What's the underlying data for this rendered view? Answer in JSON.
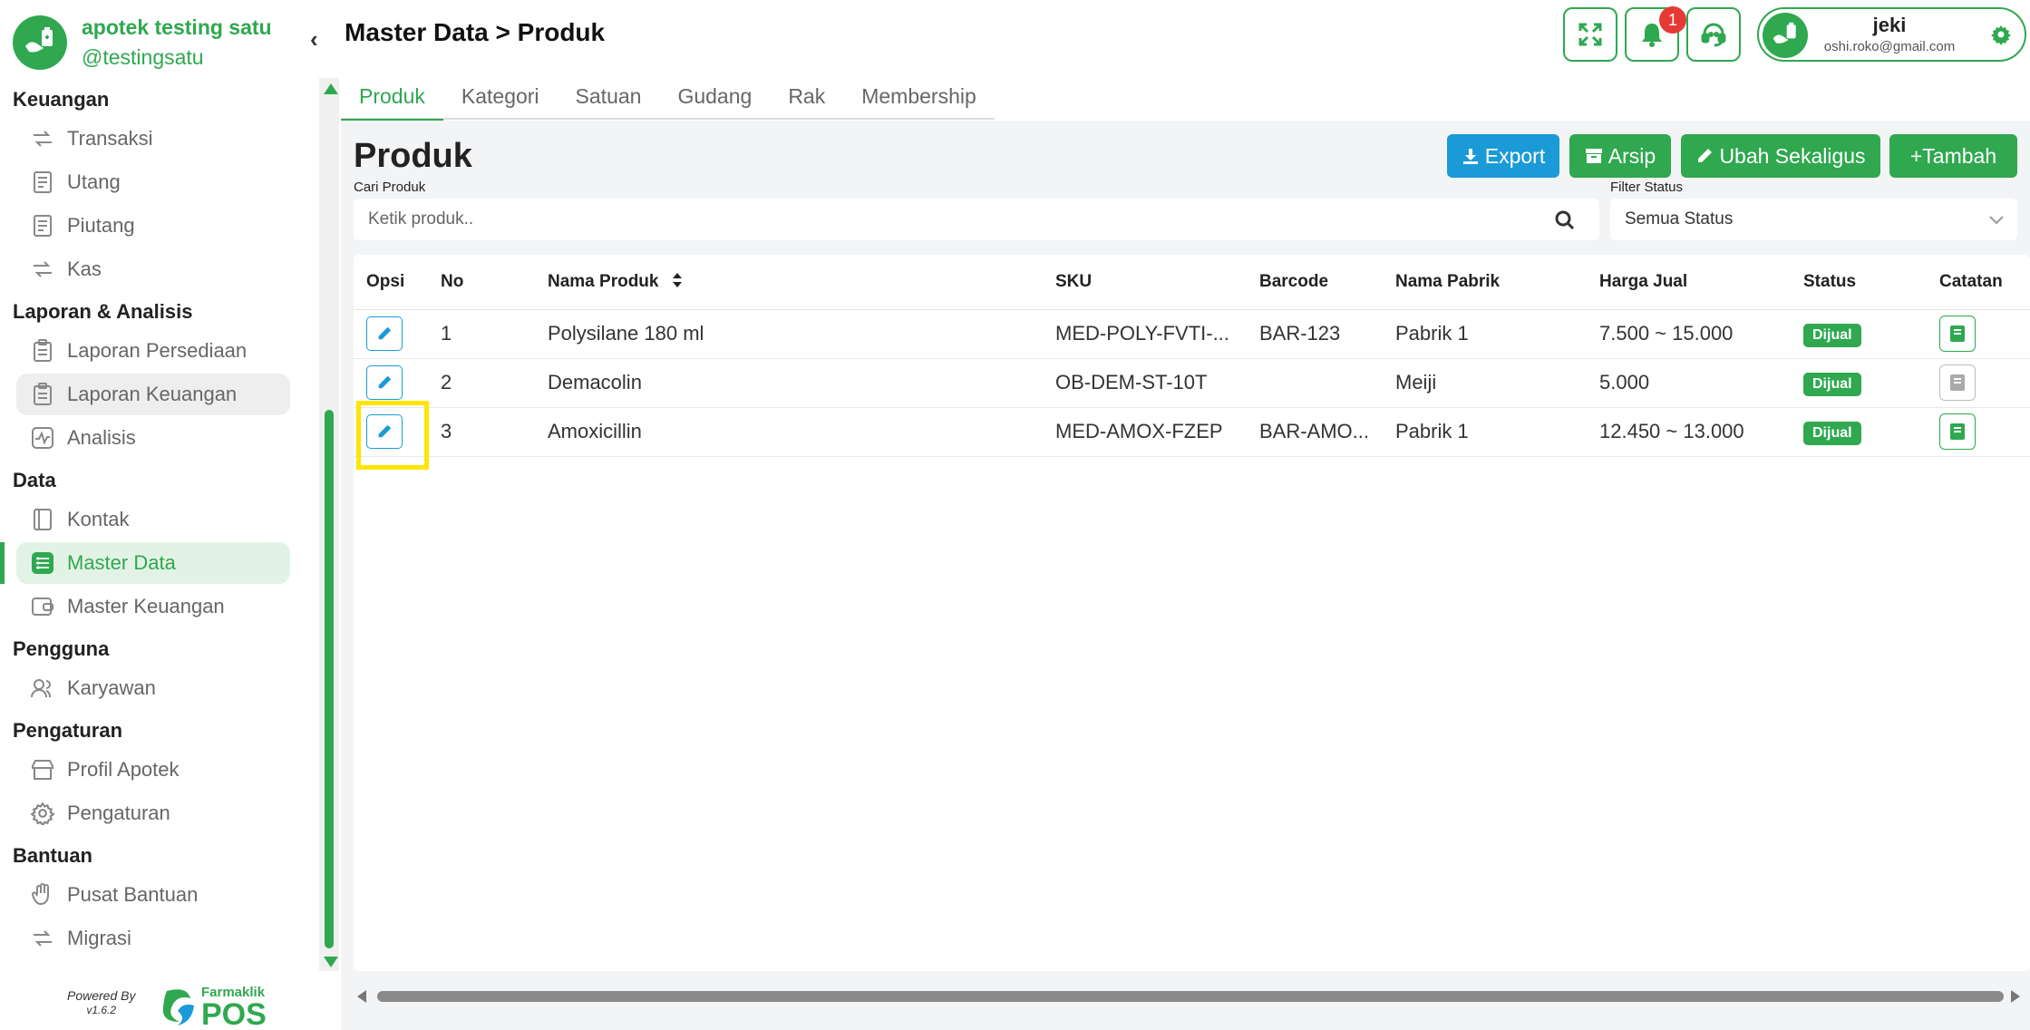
{
  "brand": {
    "name": "apotek testing satu",
    "handle": "@testingsatu"
  },
  "sidebar": {
    "sections": [
      {
        "title": "Keuangan",
        "items": [
          {
            "label": "Transaksi",
            "icon": "transfer-icon"
          },
          {
            "label": "Utang",
            "icon": "receipt-icon"
          },
          {
            "label": "Piutang",
            "icon": "receipt-icon"
          },
          {
            "label": "Kas",
            "icon": "transfer-icon"
          }
        ]
      },
      {
        "title": "Laporan & Analisis",
        "items": [
          {
            "label": "Laporan Persediaan",
            "icon": "clipboard-icon"
          },
          {
            "label": "Laporan Keuangan",
            "icon": "clipboard-icon"
          },
          {
            "label": "Analisis",
            "icon": "pulse-icon"
          }
        ]
      },
      {
        "title": "Data",
        "items": [
          {
            "label": "Kontak",
            "icon": "contact-book-icon"
          },
          {
            "label": "Master Data",
            "icon": "database-icon"
          },
          {
            "label": "Master Keuangan",
            "icon": "wallet-icon"
          }
        ]
      },
      {
        "title": "Pengguna",
        "items": [
          {
            "label": "Karyawan",
            "icon": "users-icon"
          }
        ]
      },
      {
        "title": "Pengaturan",
        "items": [
          {
            "label": "Profil Apotek",
            "icon": "store-icon"
          },
          {
            "label": "Pengaturan",
            "icon": "gear-icon"
          }
        ]
      },
      {
        "title": "Bantuan",
        "items": [
          {
            "label": "Pusat Bantuan",
            "icon": "hand-icon"
          },
          {
            "label": "Migrasi",
            "icon": "transfer-icon"
          }
        ]
      }
    ],
    "active_item": "Master Data",
    "hover_item": "Laporan Keuangan"
  },
  "footer": {
    "powered_by": "Powered By",
    "version": "v1.6.2",
    "logo_small": "Farmaklik",
    "logo_big": "POS"
  },
  "header": {
    "title": "Master Data > Produk",
    "notification_count": "1",
    "user": {
      "name": "jeki",
      "email": "oshi.roko@gmail.com"
    }
  },
  "tabs": [
    "Produk",
    "Kategori",
    "Satuan",
    "Gudang",
    "Rak",
    "Membership"
  ],
  "active_tab": "Produk",
  "main": {
    "title": "Produk",
    "buttons": {
      "export": "Export",
      "archive": "Arsip",
      "bulk_edit": "Ubah Sekaligus",
      "add": "+Tambah"
    },
    "search_label": "Cari Produk",
    "search_placeholder": "Ketik produk..",
    "filter_label": "Filter Status",
    "filter_value": "Semua Status"
  },
  "table": {
    "headers": {
      "opsi": "Opsi",
      "no": "No",
      "nama": "Nama Produk",
      "sku": "SKU",
      "barcode": "Barcode",
      "pabrik": "Nama Pabrik",
      "harga": "Harga Jual",
      "status": "Status",
      "catatan": "Catatan"
    },
    "rows": [
      {
        "no": "1",
        "nama": "Polysilane 180 ml",
        "sku": "MED-POLY-FVTI-...",
        "barcode": "BAR-123",
        "pabrik": "Pabrik 1",
        "harga": "7.500 ~ 15.000",
        "status": "Dijual",
        "has_note": true
      },
      {
        "no": "2",
        "nama": "Demacolin",
        "sku": "OB-DEM-ST-10T",
        "barcode": "",
        "pabrik": "Meiji",
        "harga": "5.000",
        "status": "Dijual",
        "has_note": false
      },
      {
        "no": "3",
        "nama": "Amoxicillin",
        "sku": "MED-AMOX-FZEP",
        "barcode": "BAR-AMO...",
        "pabrik": "Pabrik 1",
        "harga": "12.450 ~ 13.000",
        "status": "Dijual",
        "has_note": true
      }
    ]
  },
  "colors": {
    "brand_green": "#2fa84f",
    "info_blue": "#1a9bd7",
    "badge_red": "#e53935",
    "highlight_yellow": "#ffe500"
  }
}
